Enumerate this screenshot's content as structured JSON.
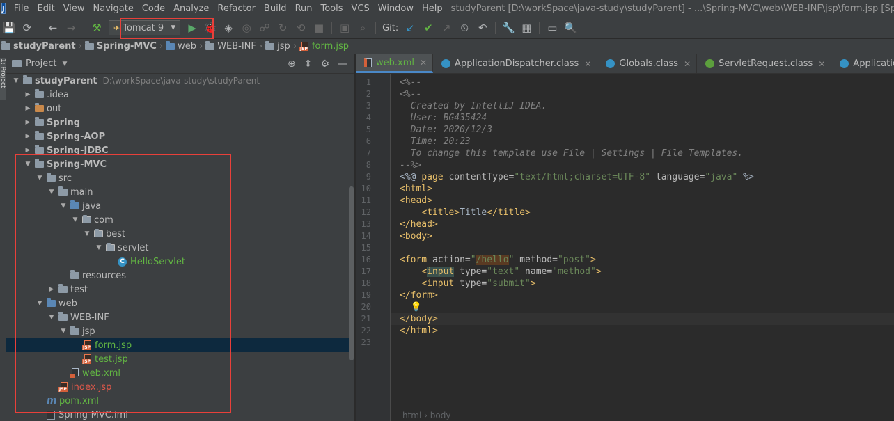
{
  "menubar": {
    "items": [
      "File",
      "Edit",
      "View",
      "Navigate",
      "Code",
      "Analyze",
      "Refactor",
      "Build",
      "Run",
      "Tools",
      "VCS",
      "Window",
      "Help"
    ],
    "title": "studyParent [D:\\workSpace\\java-study\\studyParent] - ...\\Spring-MVC\\web\\WEB-INF\\jsp\\form.jsp [Spring-MVC] - Inte"
  },
  "toolbar": {
    "run_config": "Tomcat 9",
    "git_label": "Git:"
  },
  "breadcrumbs": [
    "studyParent",
    "Spring-MVC",
    "web",
    "WEB-INF",
    "jsp",
    "form.jsp"
  ],
  "project_panel": {
    "title": "Project",
    "side_label": "1: Project",
    "root_path": "D:\\workSpace\\java-study\\studyParent",
    "tree": [
      {
        "label": "studyParent",
        "level": 0,
        "arrow": "down",
        "icon": "module",
        "bold": true
      },
      {
        "label": ".idea",
        "level": 1,
        "arrow": "right",
        "icon": "folder"
      },
      {
        "label": "out",
        "level": 1,
        "arrow": "right",
        "icon": "folder-orange"
      },
      {
        "label": "Spring",
        "level": 1,
        "arrow": "right",
        "icon": "module",
        "bold": true
      },
      {
        "label": "Spring-AOP",
        "level": 1,
        "arrow": "right",
        "icon": "module",
        "bold": true
      },
      {
        "label": "Spring-JDBC",
        "level": 1,
        "arrow": "right",
        "icon": "module",
        "bold": true
      },
      {
        "label": "Spring-MVC",
        "level": 1,
        "arrow": "down",
        "icon": "module",
        "bold": true
      },
      {
        "label": "src",
        "level": 2,
        "arrow": "down",
        "icon": "folder"
      },
      {
        "label": "main",
        "level": 3,
        "arrow": "down",
        "icon": "folder"
      },
      {
        "label": "java",
        "level": 4,
        "arrow": "down",
        "icon": "folder-blue"
      },
      {
        "label": "com",
        "level": 5,
        "arrow": "down",
        "icon": "package"
      },
      {
        "label": "best",
        "level": 6,
        "arrow": "down",
        "icon": "package"
      },
      {
        "label": "servlet",
        "level": 7,
        "arrow": "down",
        "icon": "package"
      },
      {
        "label": "HelloServlet",
        "level": 8,
        "arrow": "none",
        "icon": "class",
        "color": "green"
      },
      {
        "label": "resources",
        "level": 4,
        "arrow": "none",
        "icon": "folder"
      },
      {
        "label": "test",
        "level": 3,
        "arrow": "right",
        "icon": "folder"
      },
      {
        "label": "web",
        "level": 2,
        "arrow": "down",
        "icon": "folder-web"
      },
      {
        "label": "WEB-INF",
        "level": 3,
        "arrow": "down",
        "icon": "folder"
      },
      {
        "label": "jsp",
        "level": 4,
        "arrow": "down",
        "icon": "folder"
      },
      {
        "label": "form.jsp",
        "level": 5,
        "arrow": "none",
        "icon": "jsp",
        "color": "green",
        "selected": true
      },
      {
        "label": "test.jsp",
        "level": 5,
        "arrow": "none",
        "icon": "jsp",
        "color": "green"
      },
      {
        "label": "web.xml",
        "level": 4,
        "arrow": "none",
        "icon": "xml",
        "color": "green"
      },
      {
        "label": "index.jsp",
        "level": 3,
        "arrow": "none",
        "icon": "jsp",
        "color": "red"
      },
      {
        "label": "pom.xml",
        "level": 2,
        "arrow": "none",
        "icon": "maven",
        "color": "green"
      },
      {
        "label": "Spring-MVC.iml",
        "level": 2,
        "arrow": "none",
        "icon": "iml"
      }
    ]
  },
  "editor": {
    "tabs": [
      {
        "label": "web.xml",
        "icon": "xml",
        "active": true
      },
      {
        "label": "ApplicationDispatcher.class",
        "icon": "class"
      },
      {
        "label": "Globals.class",
        "icon": "class"
      },
      {
        "label": "ServletRequest.class",
        "icon": "interface"
      },
      {
        "label": "ApplicationHttpRequest.",
        "icon": "class"
      }
    ],
    "lines": [
      {
        "n": "1",
        "html": "<span class='cm'>&lt;%--</span>"
      },
      {
        "n": "2",
        "html": "<span class='cm'>&lt;%--</span>"
      },
      {
        "n": "3",
        "html": "<span class='cm'>  Created by IntelliJ IDEA.</span>"
      },
      {
        "n": "4",
        "html": "<span class='cm'>  User: BG435424</span>"
      },
      {
        "n": "5",
        "html": "<span class='cm'>  Date: 2020/12/3</span>"
      },
      {
        "n": "6",
        "html": "<span class='cm'>  Time: 20:23</span>"
      },
      {
        "n": "7",
        "html": "<span class='cm'>  To change this template use File | Settings | File Templates.</span>"
      },
      {
        "n": "8",
        "html": "<span class='cm'>--%&gt;</span>"
      },
      {
        "n": "9",
        "html": "<span class='dir'>&lt;%@ </span><span class='tg'>page</span> <span class='at'>contentType=</span><span class='st'>\"text/html;charset=UTF-8\"</span> <span class='at'>language=</span><span class='st'>\"java\"</span> <span class='dir'>%&gt;</span>"
      },
      {
        "n": "10",
        "html": "<span class='tg'>&lt;html&gt;</span>"
      },
      {
        "n": "11",
        "html": "<span class='tg'>&lt;head&gt;</span>"
      },
      {
        "n": "12",
        "html": "    <span class='tg'>&lt;title&gt;</span>Title<span class='tg'>&lt;/title&gt;</span>"
      },
      {
        "n": "13",
        "html": "<span class='tg'>&lt;/head&gt;</span>"
      },
      {
        "n": "14",
        "html": "<span class='tg'>&lt;body&gt;</span>"
      },
      {
        "n": "15",
        "html": ""
      },
      {
        "n": "16",
        "html": "<span class='tg'>&lt;form</span> <span class='at'>action=</span><span class='st'>\"<span class='hl-orange'>/hello</span>\"</span> <span class='at'>method=</span><span class='st'>\"post\"</span><span class='tg'>&gt;</span>"
      },
      {
        "n": "17",
        "html": "    <span class='tg'>&lt;<span class='hl-input'>input</span></span> <span class='at'>type=</span><span class='st'>\"text\"</span> <span class='at'>name=</span><span class='st'>\"method\"</span><span class='tg'>&gt;</span>"
      },
      {
        "n": "18",
        "html": "    <span class='tg'>&lt;input</span> <span class='at'>type=</span><span class='st'>\"submit\"</span><span class='tg'>&gt;</span>"
      },
      {
        "n": "19",
        "html": "<span class='tg'>&lt;/form&gt;</span>"
      },
      {
        "n": "20",
        "html": "  <span class='bulb'>💡</span>"
      },
      {
        "n": "21",
        "html": "<span class='tg'>&lt;/body&gt;</span>",
        "current": true
      },
      {
        "n": "22",
        "html": "<span class='tg'>&lt;/html&gt;</span>"
      },
      {
        "n": "23",
        "html": ""
      }
    ],
    "status_breadcrumb": "html  ›  body"
  },
  "colors": {
    "highlight": "#e8403a",
    "selection": "#0d293e",
    "tab_accent": "#4a88c7"
  }
}
